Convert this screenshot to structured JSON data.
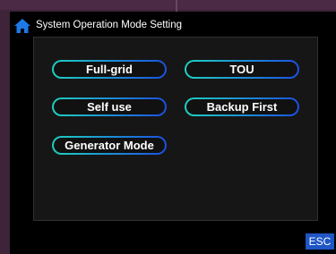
{
  "header": {
    "title": "System Operation Mode Setting",
    "icon": "home-icon"
  },
  "modes": {
    "full_grid": "Full-grid",
    "tou": "TOU",
    "self_use": "Self use",
    "backup_first": "Backup First",
    "generator_mode": "Generator Mode"
  },
  "footer": {
    "esc_label": "ESC"
  },
  "colors": {
    "accent_start": "#1fd0c0",
    "accent_end": "#1b50e0",
    "esc_bg": "#1f56c4",
    "icon": "#1e78e6"
  }
}
